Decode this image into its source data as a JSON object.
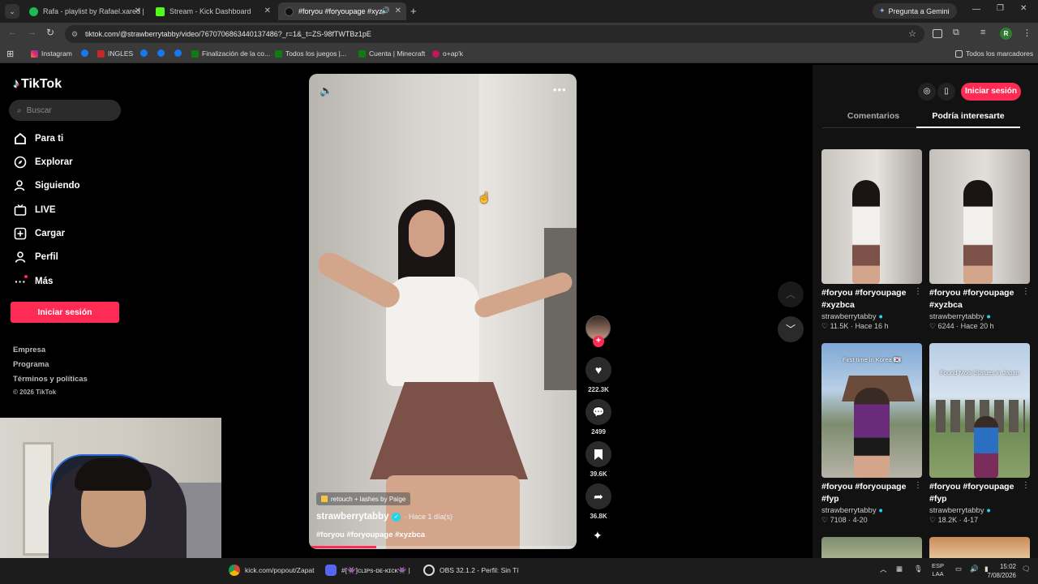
{
  "browser": {
    "tabs": [
      {
        "title": "Rafa - playlist by Rafael.xared |"
      },
      {
        "title": "Stream - Kick Dashboard"
      },
      {
        "title": "#foryou #foryoupage #xyzb"
      }
    ],
    "gemini": "Pregunta a Gemini",
    "url": "tiktok.com/@strawberrytabby/video/7670706863440137486?_r=1&_t=ZS-98fTWTBz1pE",
    "profile_initial": "R",
    "bookmarks": [
      "Instagram",
      "INGLES",
      "Finalización de la co...",
      "Todos los juegos |...",
      "Cuenta | Minecraft",
      "o+ap'k"
    ],
    "all_bookmarks": "Todos los marcadores"
  },
  "tiktok": {
    "logo": "TikTok",
    "search_placeholder": "Buscar",
    "nav": [
      "Para ti",
      "Explorar",
      "Siguiendo",
      "LIVE",
      "Cargar",
      "Perfil",
      "Más"
    ],
    "login_button": "Iniciar sesión",
    "footer": [
      "Empresa",
      "Programa",
      "Términos y políticas",
      "© 2026 TikTok"
    ]
  },
  "video": {
    "effect_label": "retouch + lashes by Paige",
    "author": "strawberrytabby",
    "time": "· Hace 1 día(s)",
    "caption": "#foryou #foryoupage #xyzbca",
    "progress": 0.25,
    "likes": "222.3K",
    "comments": "2499",
    "saves": "39.6K",
    "shares": "36.8K"
  },
  "right_panel": {
    "login_button": "Iniciar sesión",
    "tabs": [
      "Comentarios",
      "Podría interesarte"
    ],
    "active_tab": "Podría interesarte",
    "cards": [
      {
        "title": "#foryou #foryoupage #xyzbca",
        "author": "strawberrytabby",
        "likes": "11.5K",
        "time": "Hace 16 h",
        "overlay": ""
      },
      {
        "title": "#foryou #foryoupage #xyzbca",
        "author": "strawberrytabby",
        "likes": "6244",
        "time": "Hace 20 h",
        "overlay": ""
      },
      {
        "title": "#foryou #foryoupage #fyp",
        "author": "strawberrytabby",
        "likes": "7108",
        "time": "4-20",
        "overlay": "First time in Korea 🇰🇷"
      },
      {
        "title": "#foryou #foryoupage #fyp",
        "author": "strawberrytabby",
        "likes": "18.2K",
        "time": "4-17",
        "overlay": "Found Moai Statues in Japan"
      }
    ]
  },
  "taskbar": {
    "items": [
      "kick.com/popout/Zapat",
      "#[👾]ᴄʟɪᴘs-ᴅᴇ-ᴋɪᴄᴋ👾 |",
      "OBS 32.1.2 - Perfil: Sin Tí"
    ],
    "lang": "ESP",
    "lang2": "LAA",
    "time": "15:02",
    "date": "7/08/2026"
  }
}
